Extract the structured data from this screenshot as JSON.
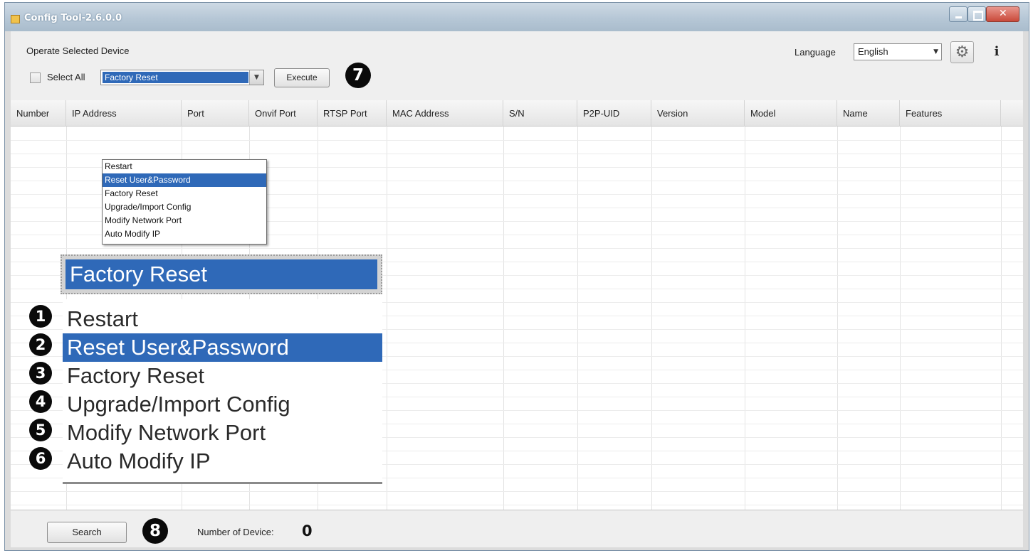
{
  "window": {
    "title": "Config Tool-2.6.0.0"
  },
  "toolbar": {
    "operate_label": "Operate Selected Device",
    "select_all_label": "Select All",
    "select_all_checked": false,
    "operation_selected": "Factory Reset",
    "execute_label": "Execute",
    "language_label": "Language",
    "language_value": "English"
  },
  "dropdown": {
    "options": [
      "Restart",
      "Reset User&Password",
      "Factory Reset",
      "Upgrade/Import Config",
      "Modify Network Port",
      "Auto Modify IP"
    ],
    "highlighted_index": 1
  },
  "zoom_callout": {
    "combo_value": "Factory Reset",
    "items": [
      {
        "marker": "1",
        "label": "Restart"
      },
      {
        "marker": "2",
        "label": "Reset User&Password"
      },
      {
        "marker": "3",
        "label": "Factory Reset"
      },
      {
        "marker": "4",
        "label": "Upgrade/Import Config"
      },
      {
        "marker": "5",
        "label": "Modify Network Port"
      },
      {
        "marker": "6",
        "label": "Auto Modify IP"
      }
    ]
  },
  "markers": {
    "execute": "7",
    "search": "8"
  },
  "table": {
    "columns": [
      "Number",
      "IP Address",
      "Port",
      "Onvif Port",
      "RTSP Port",
      "MAC Address",
      "S/N",
      "P2P-UID",
      "Version",
      "Model",
      "Name",
      "Features"
    ],
    "rows": []
  },
  "footer": {
    "search_label": "Search",
    "device_count_label": "Number of Device:",
    "device_count": "0"
  },
  "colors": {
    "selection": "#2f69b8",
    "title_bar": "#b6c7d6",
    "close_button": "#c9493a"
  },
  "icons": {
    "settings": "gear-icon",
    "info": "info-icon",
    "window_app": "app-icon"
  }
}
